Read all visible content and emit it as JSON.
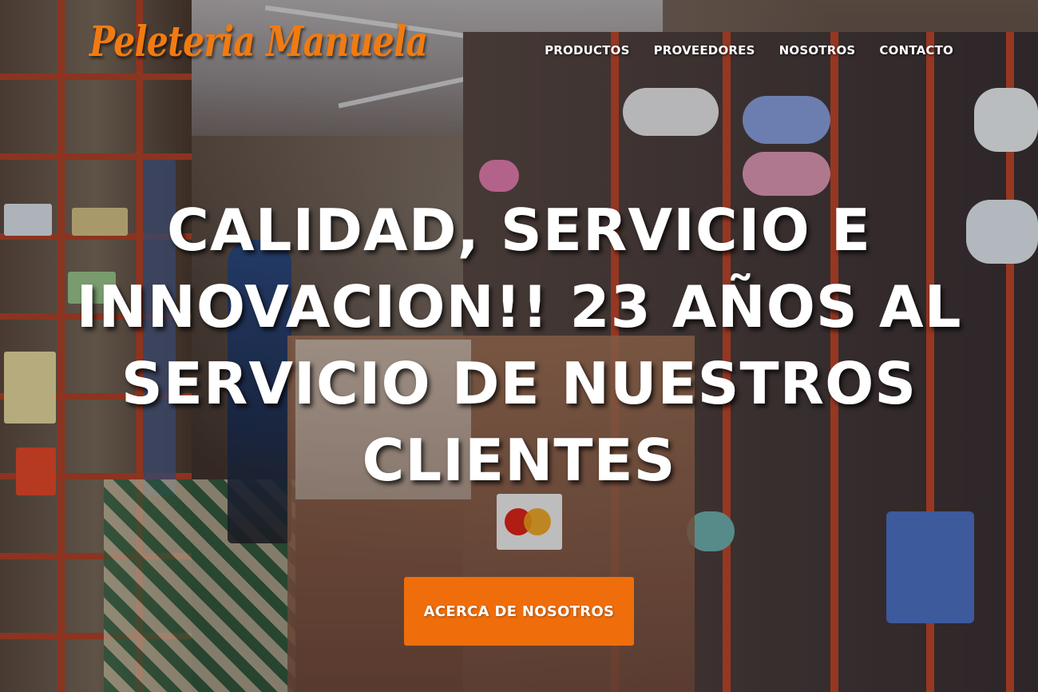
{
  "brand": {
    "logo_text": "Peleteria Manuela",
    "accent_color": "#f07b12",
    "button_color": "#f06d0c"
  },
  "nav": {
    "items": [
      {
        "label": "PRODUCTOS"
      },
      {
        "label": "PROVEEDORES"
      },
      {
        "label": "NOSOTROS"
      },
      {
        "label": "CONTACTO"
      }
    ]
  },
  "hero": {
    "headline": "CALIDAD, SERVICIO E INNOVACION!! 23 AÑOS AL SERVICIO DE NUESTROS CLIENTES",
    "cta_label": "ACERCA DE NOSOTROS",
    "background": "store-interior-photo"
  }
}
